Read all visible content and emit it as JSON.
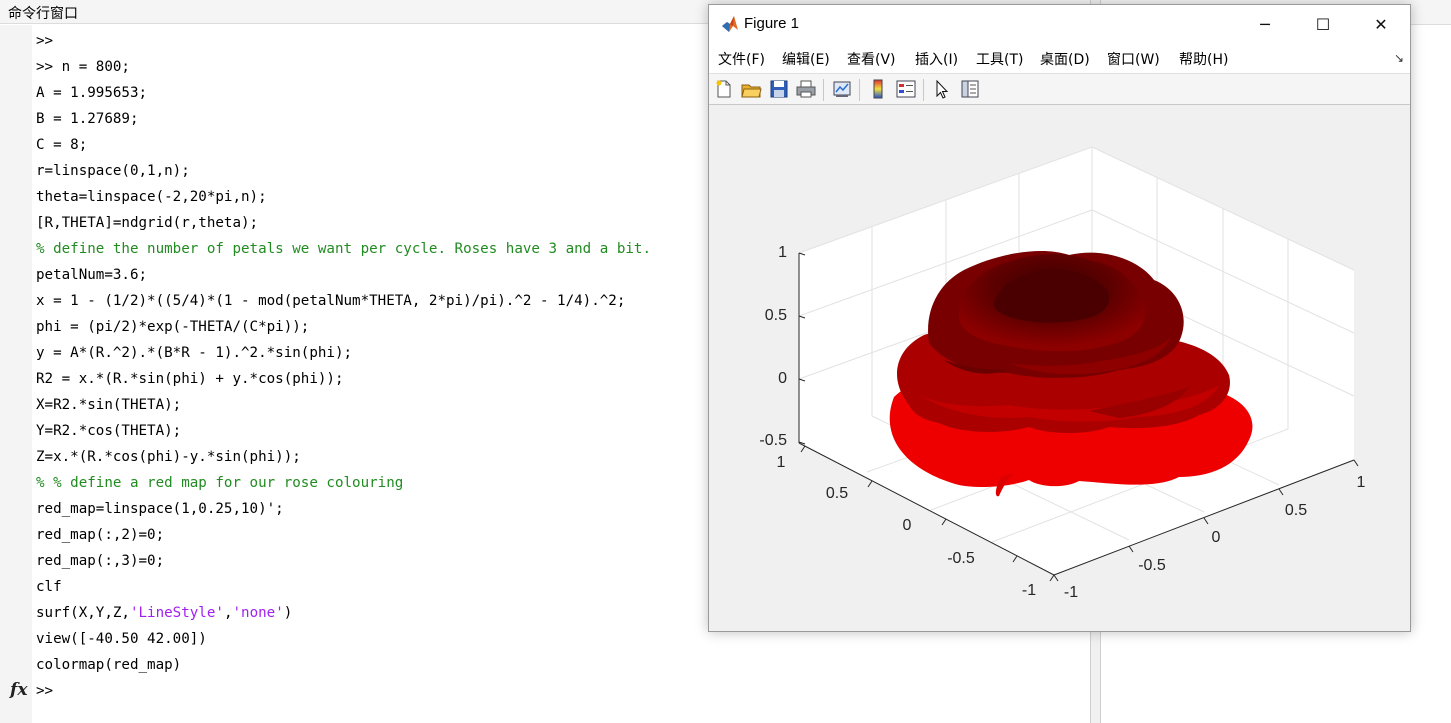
{
  "command_window": {
    "title": "命令行窗口",
    "lines": [
      {
        "text": ">>",
        "kind": "prompt"
      },
      {
        "text": ">> n = 800;",
        "kind": "code"
      },
      {
        "text": "A = 1.995653;",
        "kind": "code"
      },
      {
        "text": "B = 1.27689;",
        "kind": "code"
      },
      {
        "text": "C = 8;",
        "kind": "code"
      },
      {
        "text": "r=linspace(0,1,n);",
        "kind": "code"
      },
      {
        "text": "theta=linspace(-2,20*pi,n);",
        "kind": "code"
      },
      {
        "text": "[R,THETA]=ndgrid(r,theta);",
        "kind": "code"
      },
      {
        "text": "% define the number of petals we want per cycle. Roses have 3 and a bit.",
        "kind": "comment"
      },
      {
        "text": "petalNum=3.6;",
        "kind": "code"
      },
      {
        "text": "x = 1 - (1/2)*((5/4)*(1 - mod(petalNum*THETA, 2*pi)/pi).^2 - 1/4).^2;",
        "kind": "code"
      },
      {
        "text": "phi = (pi/2)*exp(-THETA/(C*pi));",
        "kind": "code"
      },
      {
        "text": "y = A*(R.^2).*(B*R - 1).^2.*sin(phi);",
        "kind": "code"
      },
      {
        "text": "R2 = x.*(R.*sin(phi) + y.*cos(phi));",
        "kind": "code"
      },
      {
        "text": "X=R2.*sin(THETA);",
        "kind": "code"
      },
      {
        "text": "Y=R2.*cos(THETA);",
        "kind": "code"
      },
      {
        "text": "Z=x.*(R.*cos(phi)-y.*sin(phi));",
        "kind": "code"
      },
      {
        "text": "% % define a red map for our rose colouring",
        "kind": "comment"
      },
      {
        "text": "red_map=linspace(1,0.25,10)';",
        "kind": "code"
      },
      {
        "text": "red_map(:,2)=0;",
        "kind": "code"
      },
      {
        "text": "red_map(:,3)=0;",
        "kind": "code"
      },
      {
        "text": "clf",
        "kind": "code"
      },
      {
        "segments": [
          {
            "text": "surf(X,Y,Z,",
            "kind": "code"
          },
          {
            "text": "'LineStyle'",
            "kind": "string"
          },
          {
            "text": ",",
            "kind": "code"
          },
          {
            "text": "'none'",
            "kind": "string"
          },
          {
            "text": ")",
            "kind": "code"
          }
        ]
      },
      {
        "text": "view([-40.50 42.00])",
        "kind": "code"
      },
      {
        "text": "colormap(red_map)",
        "kind": "code"
      },
      {
        "text": ">>",
        "kind": "prompt"
      }
    ],
    "fx_icon_text": "fx",
    "colors": {
      "code": "#000000",
      "comment": "#228b22",
      "string": "#a020f0"
    }
  },
  "figure": {
    "title": "Figure 1",
    "window_buttons": {
      "minimize": "─",
      "maximize": "☐",
      "close": "✕"
    },
    "menu": [
      "文件(F)",
      "编辑(E)",
      "查看(V)",
      "插入(I)",
      "工具(T)",
      "桌面(D)",
      "窗口(W)",
      "帮助(H)"
    ],
    "dock_arrow": "↘",
    "toolbar_icons": [
      "new-figure-icon",
      "open-file-icon",
      "save-icon",
      "print-icon",
      "link-plot-icon",
      "colorbar-icon",
      "legend-icon",
      "edit-plot-pointer-icon",
      "property-inspector-icon"
    ]
  },
  "chart_data": {
    "type": "surface",
    "view": {
      "azimuth": -40.5,
      "elevation": 42.0
    },
    "xlim": [
      -1,
      1
    ],
    "ylim": [
      -1,
      1
    ],
    "zlim": [
      -0.5,
      1
    ],
    "z_ticks": [
      "1",
      "0.5",
      "0",
      "-0.5"
    ],
    "x_ticks": [
      "1",
      "0.5",
      "0",
      "-0.5",
      "-1"
    ],
    "y_ticks": [
      "1",
      "0.5",
      "0",
      "-0.5",
      "-1"
    ],
    "grid": true,
    "colormap": {
      "name": "red_map",
      "from": "#ff0000",
      "to": "#400000",
      "steps": 10
    }
  }
}
